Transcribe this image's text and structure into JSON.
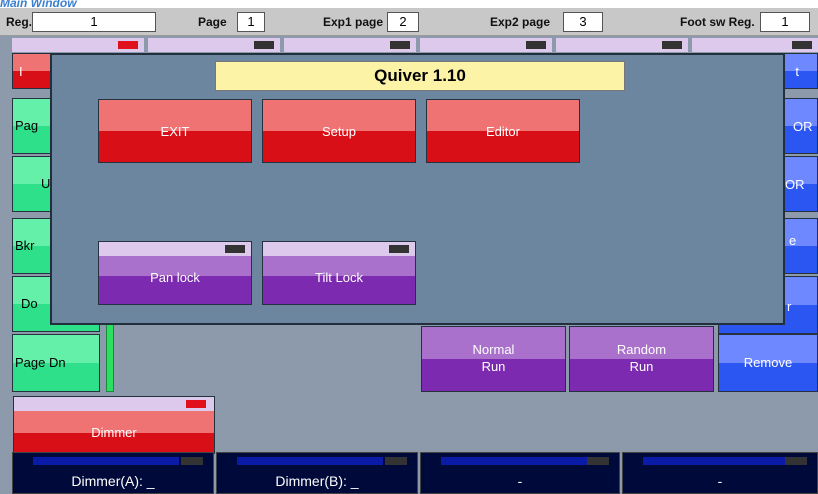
{
  "window_caption": "Main Window",
  "topbar": {
    "reg_label": "Reg.",
    "reg_value": "1",
    "page_label": "Page",
    "page_value": "1",
    "exp1_label": "Exp1 page",
    "exp1_value": "2",
    "exp2_label": "Exp2 page",
    "exp2_value": "3",
    "foot_label": "Foot sw Reg.",
    "foot_value": "1"
  },
  "left_buttons": [
    "I",
    "Pag",
    "U",
    "Bkr",
    "Do",
    "Page Dn"
  ],
  "right_buttons": [
    "t",
    "OR",
    "OR",
    "e",
    "r",
    "Remove"
  ],
  "run_buttons": {
    "normal": "Normal\nRun",
    "random": "Random\nRun"
  },
  "dimmer_button": "Dimmer",
  "bottom_slots": [
    "Dimmer(A): _",
    "Dimmer(B): _",
    "-",
    "-"
  ],
  "dialog": {
    "title": "Quiver 1.10",
    "exit": "EXIT",
    "setup": "Setup",
    "editor": "Editor",
    "pan_lock": "Pan lock",
    "tilt_lock": "Tilt Lock"
  },
  "colors": {
    "accent_red": "#d90f18",
    "accent_blue": "#2c56f2",
    "accent_purple": "#7c2bb0",
    "accent_green": "#2ee08a",
    "dialog_bg": "#6d86a0",
    "title_bg": "#fdf3a6"
  }
}
